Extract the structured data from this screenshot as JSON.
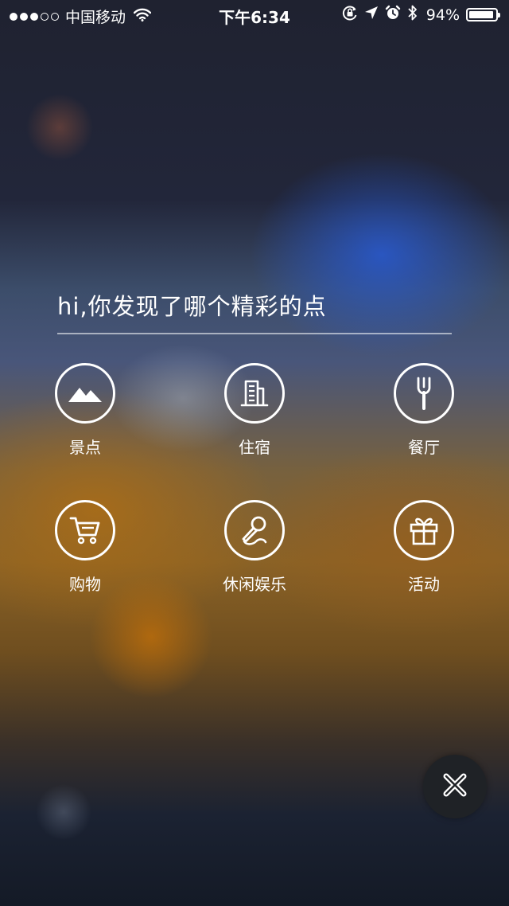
{
  "status_bar": {
    "carrier": "中国移动",
    "signal_filled": 3,
    "signal_total": 5,
    "time": "下午6:34",
    "battery_percent_label": "94%",
    "battery_level": 0.94,
    "icons": [
      "wifi-icon",
      "rotation-lock-icon",
      "location-arrow-icon",
      "alarm-icon",
      "bluetooth-icon",
      "battery-icon"
    ]
  },
  "prompt": {
    "text": "hi,你发现了哪个精彩的点"
  },
  "categories": [
    {
      "label": "景点",
      "icon": "mountain-icon"
    },
    {
      "label": "住宿",
      "icon": "building-icon"
    },
    {
      "label": "餐厅",
      "icon": "fork-icon"
    },
    {
      "label": "购物",
      "icon": "shopping-cart-icon"
    },
    {
      "label": "休闲娱乐",
      "icon": "microphone-icon"
    },
    {
      "label": "活动",
      "icon": "gift-icon"
    }
  ],
  "close_button": {
    "icon": "close-icon"
  }
}
